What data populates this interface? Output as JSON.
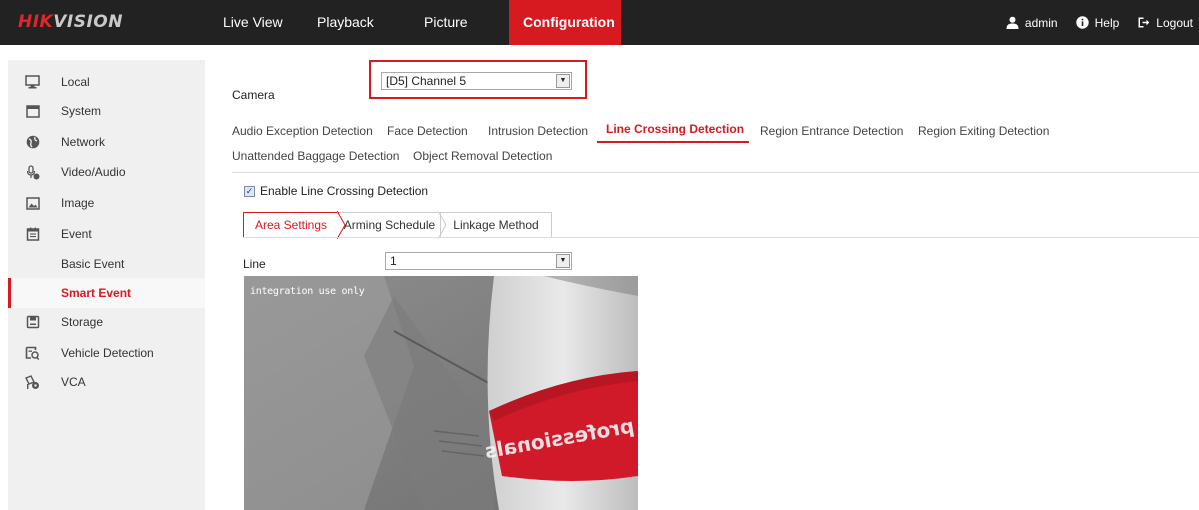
{
  "brand": {
    "hik": "HIK",
    "vision": "VISION"
  },
  "nav": {
    "items": [
      {
        "label": "Live View"
      },
      {
        "label": "Playback"
      },
      {
        "label": "Picture"
      },
      {
        "label": "Configuration",
        "active": true
      }
    ],
    "user": {
      "label": "admin",
      "icon": "user-icon"
    },
    "help": {
      "label": "Help",
      "icon": "info-icon"
    },
    "logout": {
      "label": "Logout",
      "icon": "logout-icon"
    }
  },
  "sidebar": {
    "items": [
      {
        "label": "Local",
        "icon": "monitor-icon"
      },
      {
        "label": "System",
        "icon": "window-icon"
      },
      {
        "label": "Network",
        "icon": "globe-icon"
      },
      {
        "label": "Video/Audio",
        "icon": "mic-icon"
      },
      {
        "label": "Image",
        "icon": "image-icon"
      },
      {
        "label": "Event",
        "icon": "calendar-icon"
      },
      {
        "label": "Basic Event"
      },
      {
        "label": "Smart Event",
        "selected": true
      },
      {
        "label": "Storage",
        "icon": "disk-icon"
      },
      {
        "label": "Vehicle Detection",
        "icon": "vehicle-icon"
      },
      {
        "label": "VCA",
        "icon": "camera-settings-icon"
      }
    ]
  },
  "camera": {
    "label": "Camera",
    "value": "[D5] Channel 5"
  },
  "tabs": [
    {
      "label": "Audio Exception Detection"
    },
    {
      "label": "Face Detection"
    },
    {
      "label": "Intrusion Detection"
    },
    {
      "label": "Line Crossing Detection",
      "active": true
    },
    {
      "label": "Region Entrance Detection"
    },
    {
      "label": "Region Exiting Detection"
    },
    {
      "label": "Unattended Baggage Detection"
    },
    {
      "label": "Object Removal Detection"
    }
  ],
  "enable": {
    "label": "Enable Line Crossing Detection",
    "checked": true
  },
  "subtabs": [
    {
      "label": "Area Settings",
      "active": true
    },
    {
      "label": "Arming Schedule"
    },
    {
      "label": "Linkage Method"
    }
  ],
  "line": {
    "label": "Line",
    "value": "1"
  },
  "video": {
    "osd": "integration use only",
    "banner_text": "professionals"
  },
  "colors": {
    "accent": "#d71920",
    "topbar": "#222222",
    "sidebar": "#f0f0f0"
  }
}
